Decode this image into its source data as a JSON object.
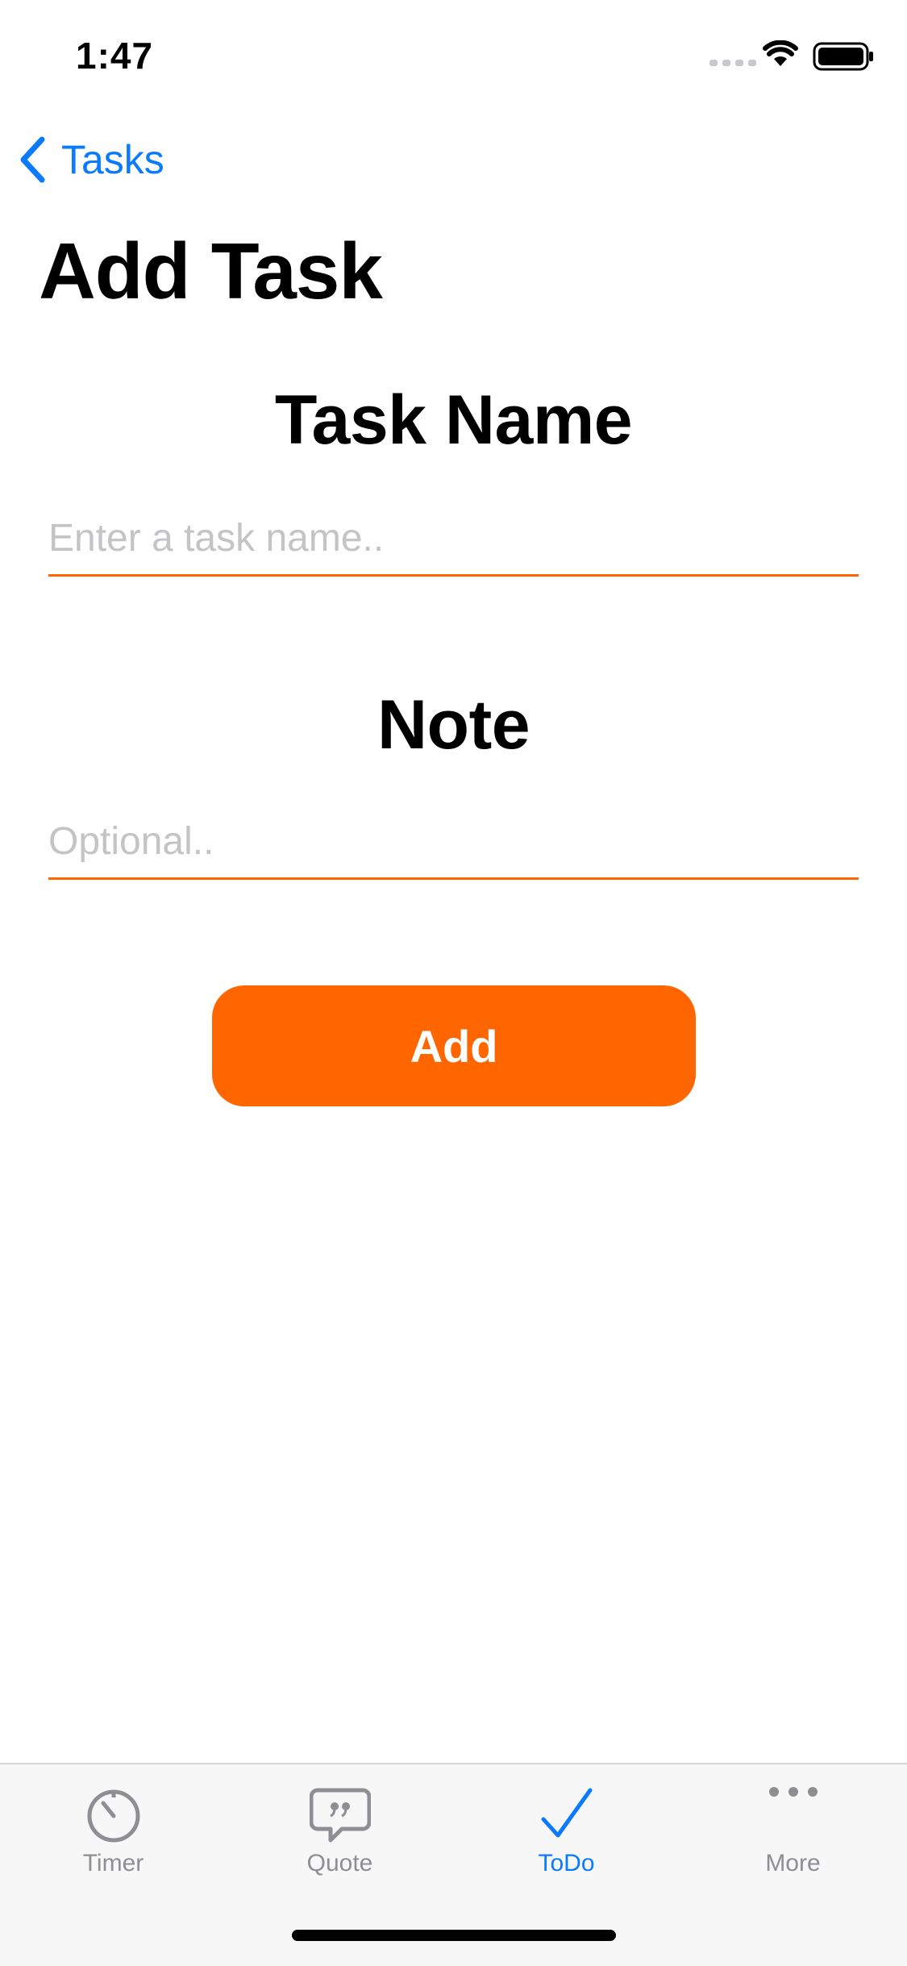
{
  "status_bar": {
    "time": "1:47"
  },
  "nav": {
    "back_label": "Tasks",
    "title": "Add Task"
  },
  "form": {
    "task_name_label": "Task Name",
    "task_name_placeholder": "Enter a task name..",
    "note_label": "Note",
    "note_placeholder": "Optional..",
    "add_label": "Add"
  },
  "tab_bar": {
    "tabs": [
      {
        "label": "Timer",
        "icon": "timer-icon",
        "active": false
      },
      {
        "label": "Quote",
        "icon": "quote-bubble-icon",
        "active": false
      },
      {
        "label": "ToDo",
        "icon": "checkmark-icon",
        "active": true
      },
      {
        "label": "More",
        "icon": "more-dots-icon",
        "active": false
      }
    ]
  },
  "colors": {
    "accent": "#ff6600",
    "link": "#0a7aff",
    "inactive": "#8e8e93"
  }
}
